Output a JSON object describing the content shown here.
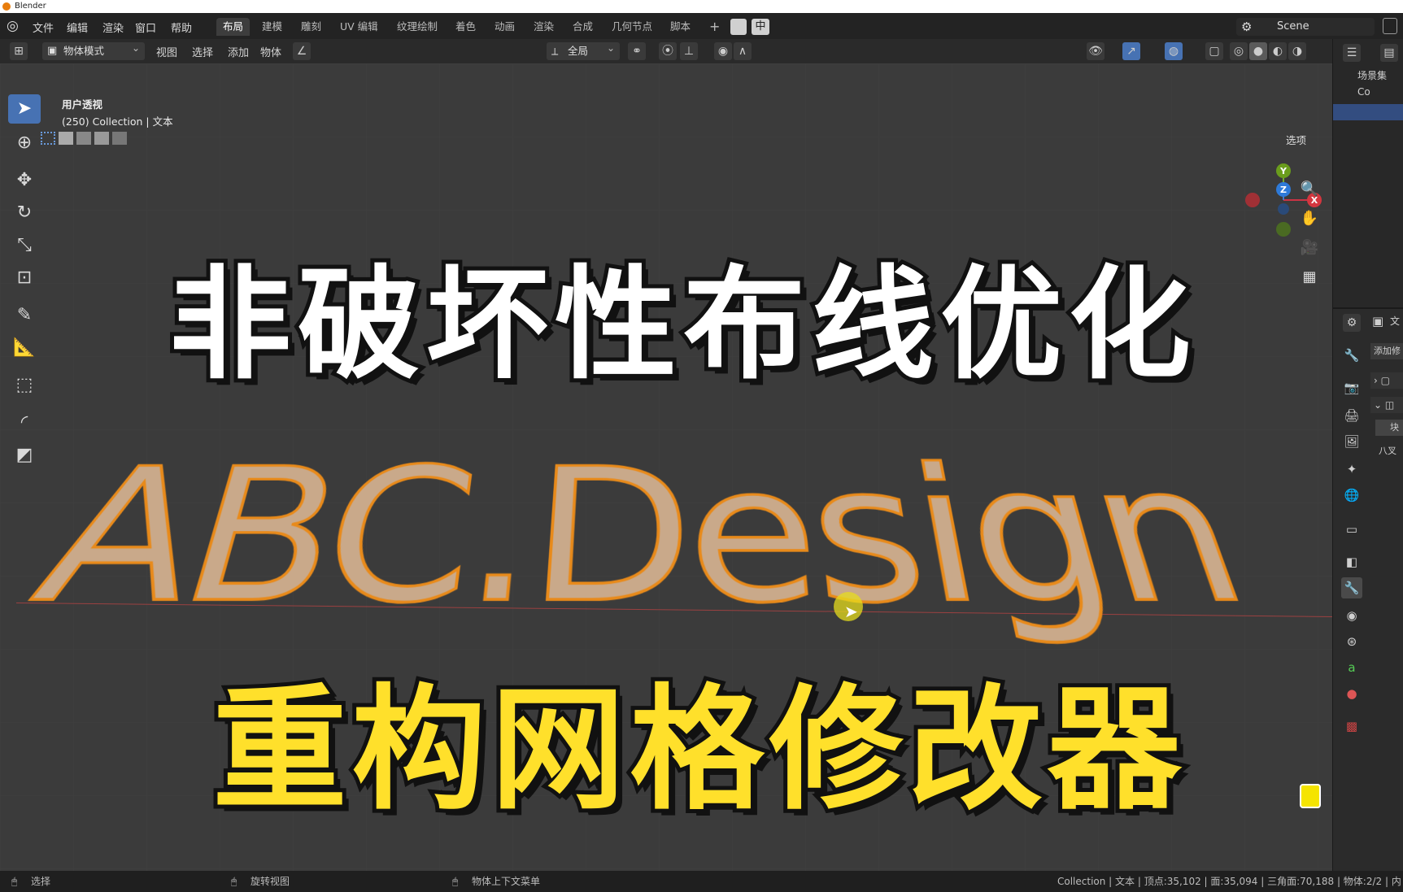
{
  "window": {
    "title": "Blender"
  },
  "menu": [
    "文件",
    "编辑",
    "渲染",
    "窗口",
    "帮助"
  ],
  "workspace_tabs": [
    "布局",
    "建模",
    "雕刻",
    "UV 编辑",
    "纹理绘制",
    "着色",
    "动画",
    "渲染",
    "合成",
    "几何节点",
    "脚本"
  ],
  "active_workspace": "布局",
  "ime_indicator": "中",
  "scene": {
    "name": "Scene"
  },
  "header": {
    "mode": "物体模式",
    "menus": [
      "视图",
      "选择",
      "添加",
      "物体"
    ],
    "transform_orientation": "全局",
    "options_label": "选项"
  },
  "viewport_info": {
    "view_name": "用户透视",
    "context": "(250) Collection | 文本"
  },
  "scene_text": "ABC.Design",
  "overlay_titles": {
    "line1": "非破坏性布线优化",
    "line2": "重构网格修改器"
  },
  "gizmo": {
    "x": "X",
    "y": "Y",
    "z": "Z"
  },
  "outliner": {
    "label": "场景集",
    "item": "Co"
  },
  "properties": {
    "tab_label": "文",
    "add_modifier": "添加修",
    "field1": "块",
    "field2": "八叉"
  },
  "statusbar": {
    "left_action": "选择",
    "middle_action": "旋转视图",
    "right_action": "物体上下文菜单",
    "stats": "Collection | 文本 | 顶点:35,102 | 面:35,094 | 三角面:70,188 | 物体:2/2 | 内"
  }
}
